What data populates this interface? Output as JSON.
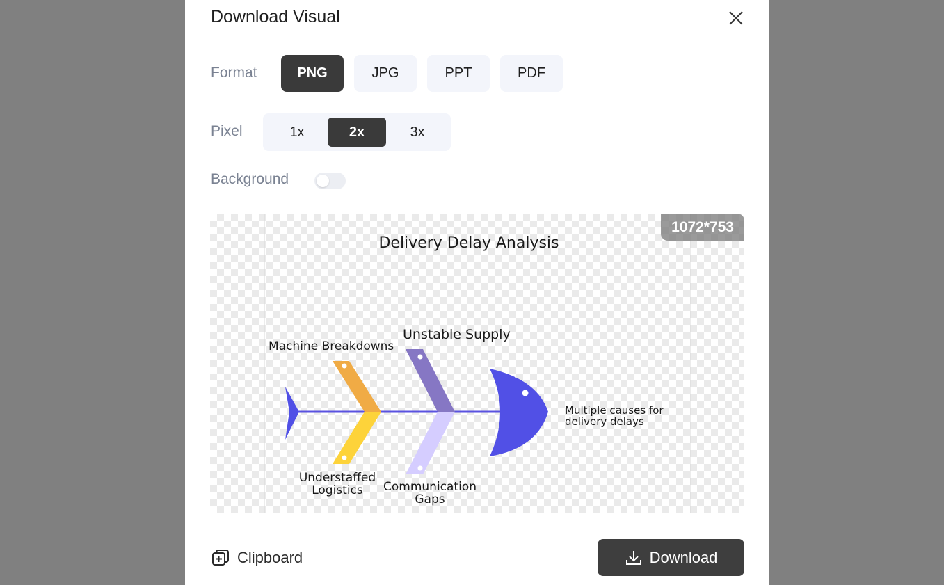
{
  "dialog": {
    "title": "Download Visual"
  },
  "format": {
    "label": "Format",
    "options": [
      "PNG",
      "JPG",
      "PPT",
      "PDF"
    ],
    "selected": "PNG"
  },
  "pixel": {
    "label": "Pixel",
    "options": [
      "1x",
      "2x",
      "3x"
    ],
    "selected": "2x"
  },
  "background": {
    "label": "Background",
    "enabled": false
  },
  "preview": {
    "dimensions": "1072*753",
    "diagram": {
      "title": "Delivery Delay Analysis",
      "head_label_line1": "Multiple causes for",
      "head_label_line2": "delivery delays",
      "top_causes": [
        "Machine Breakdowns",
        "Unstable Supply"
      ],
      "bottom_cause_1_line1": "Understaffed",
      "bottom_cause_1_line2": "Logistics",
      "bottom_cause_2_line1": "Communication",
      "bottom_cause_2_line2": "Gaps",
      "colors": {
        "spine": "#5a52e0",
        "head": "#5150e6",
        "machine": "#f0ab45",
        "supply": "#8677c4",
        "logistics": "#fdd33a",
        "communication": "#d5cdff"
      }
    }
  },
  "footer": {
    "clipboard_label": "Clipboard",
    "download_label": "Download"
  },
  "icons": [
    "close-icon",
    "clipboard-icon",
    "download-icon"
  ]
}
